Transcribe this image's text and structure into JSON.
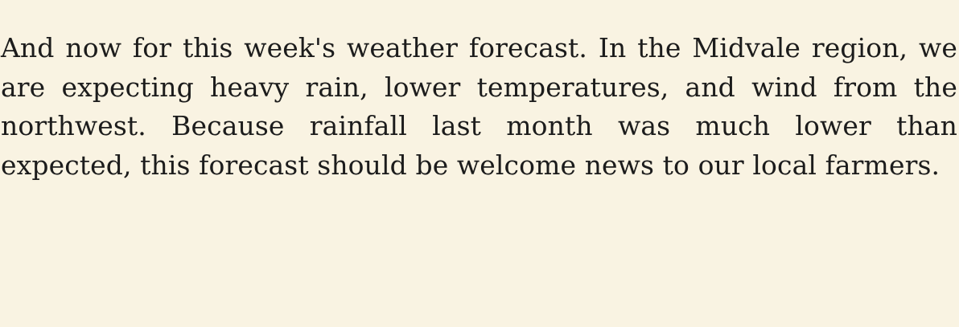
{
  "passage": {
    "text": "And now for this week's weather forecast. In the Midvale region, we are expecting heavy rain, lower temperatures, and wind from the northwest. Because rainfall last month was much lower than expected, this forecast should be welcome news to our local farmers."
  }
}
